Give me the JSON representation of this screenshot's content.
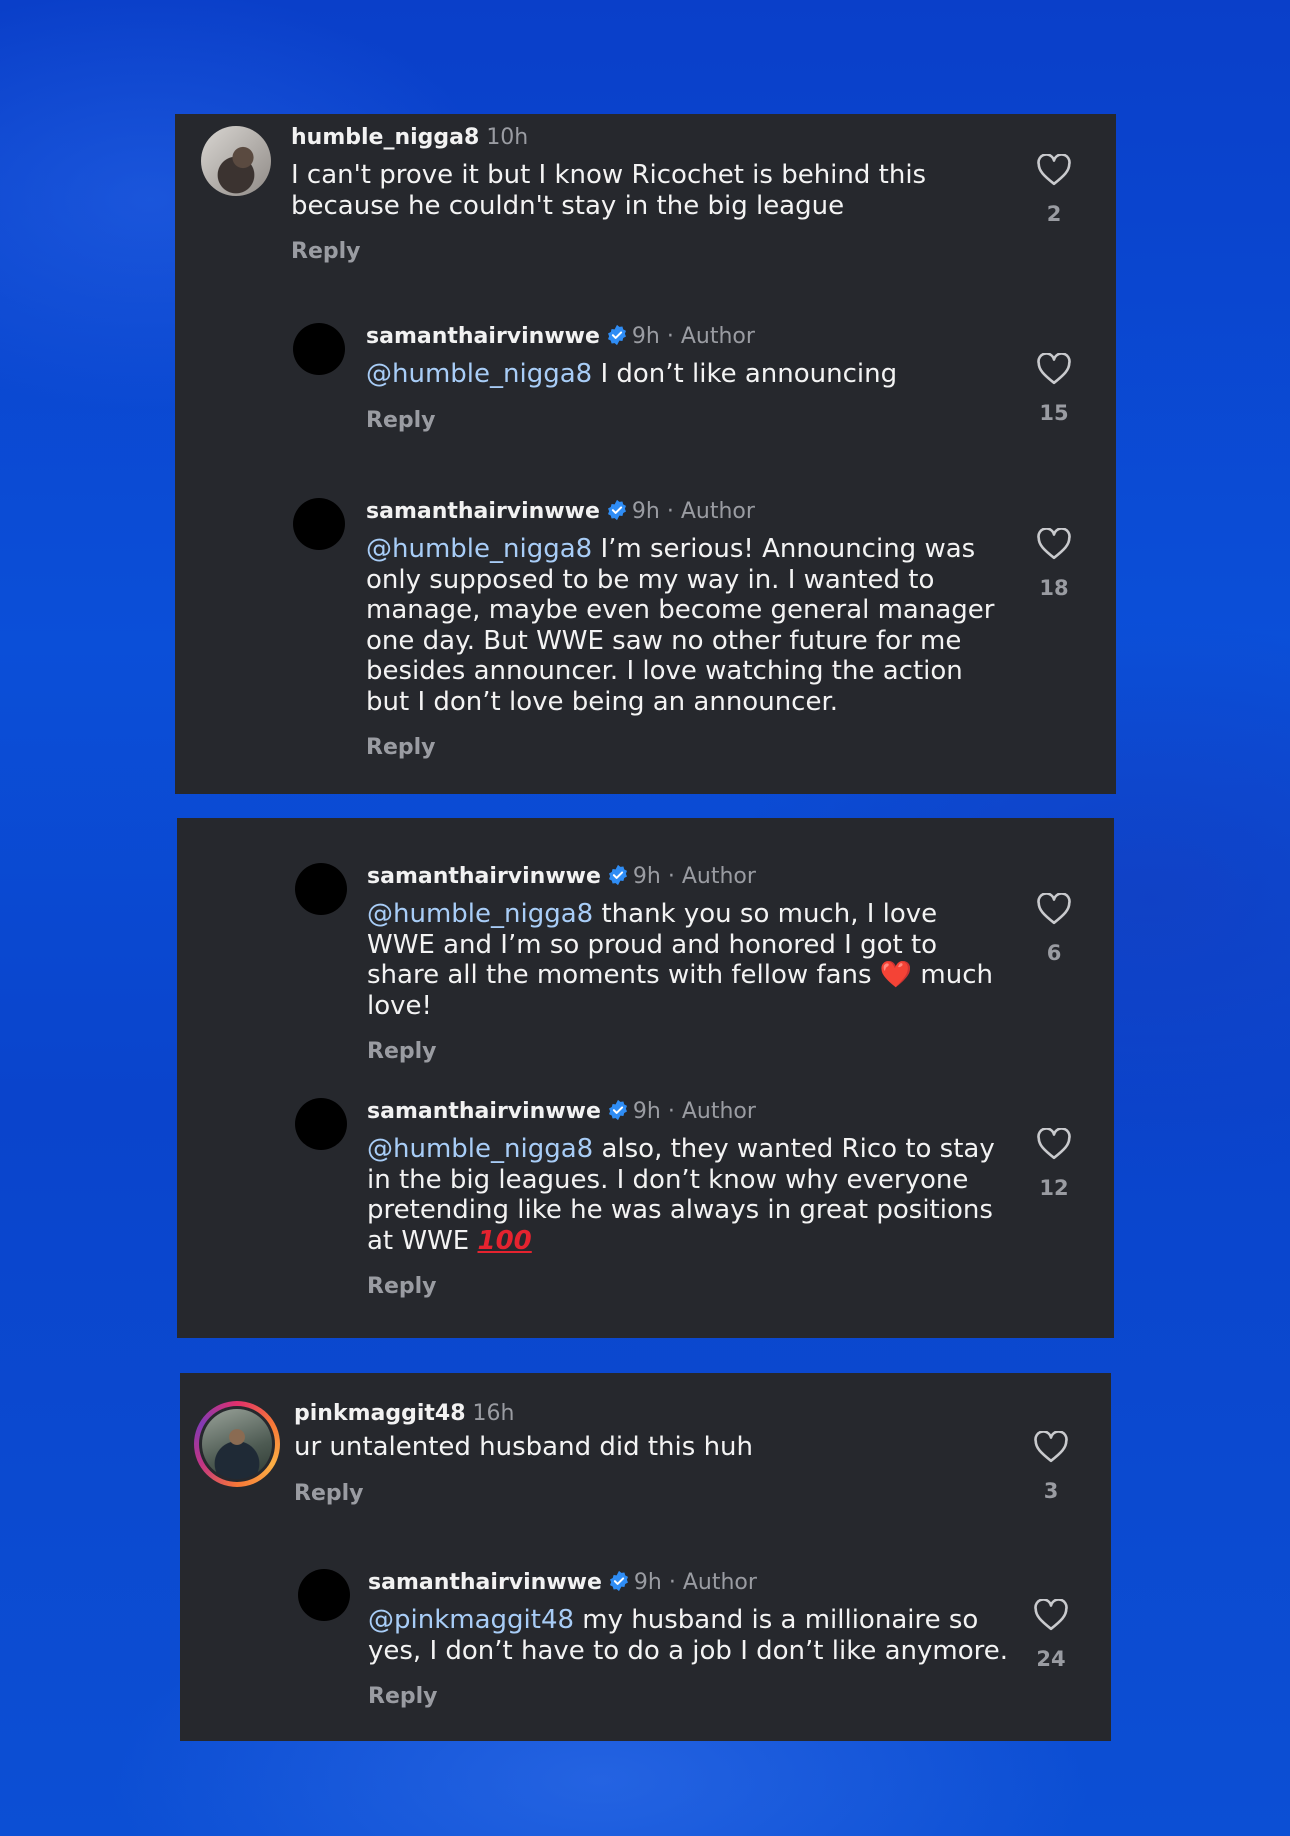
{
  "icons": {
    "like": "heart-outline-icon",
    "verified": "verified-badge-icon"
  },
  "colors": {
    "card": "#26282d",
    "mention": "#a8cdf7",
    "verified": "#2f8df5",
    "background": "#0b4fd8"
  },
  "comments": [
    {
      "username": "humble_nigga8",
      "time": "10h",
      "text": "I can't prove it but I know Ricochet is behind this because he couldn't stay in the big league",
      "reply": "Reply",
      "likes": "2"
    },
    {
      "username": "samanthairvinwwe",
      "time": "9h",
      "sep": "·",
      "role": "Author",
      "mention": "@humble_nigga8",
      "text": " I don’t like announcing",
      "reply": "Reply",
      "likes": "15"
    },
    {
      "username": "samanthairvinwwe",
      "time": "9h",
      "sep": "·",
      "role": "Author",
      "mention": "@humble_nigga8",
      "text": " I’m serious! Announcing was only supposed to be my way in. I wanted to manage, maybe even become general manager one day. But WWE saw no other future for me besides announcer. I love watching the action but I don’t love being an announcer.",
      "reply": "Reply",
      "likes": "18"
    },
    {
      "username": "samanthairvinwwe",
      "time": "9h",
      "sep": "·",
      "role": "Author",
      "mention": "@humble_nigga8",
      "text": " thank you so much, I love WWE and I’m so proud and honored I got to share all the moments with fellow fans ",
      "emoji": "❤️",
      "text_after": " much love!",
      "reply": "Reply",
      "likes": "6"
    },
    {
      "username": "samanthairvinwwe",
      "time": "9h",
      "sep": "·",
      "role": "Author",
      "mention": "@humble_nigga8",
      "text": " also, they wanted Rico to stay in the big leagues. I don’t know why everyone pretending like he was always in great positions at WWE ",
      "emoji": "100",
      "reply": "Reply",
      "likes": "12"
    },
    {
      "username": "pinkmaggit48",
      "time": "16h",
      "text": "ur untalented husband did this huh",
      "reply": "Reply",
      "likes": "3"
    },
    {
      "username": "samanthairvinwwe",
      "time": "9h",
      "sep": "·",
      "role": "Author",
      "mention": "@pinkmaggit48",
      "text": " my husband is a millionaire so yes, I don’t have to do a job I don’t like anymore.",
      "reply": "Reply",
      "likes": "24"
    }
  ]
}
